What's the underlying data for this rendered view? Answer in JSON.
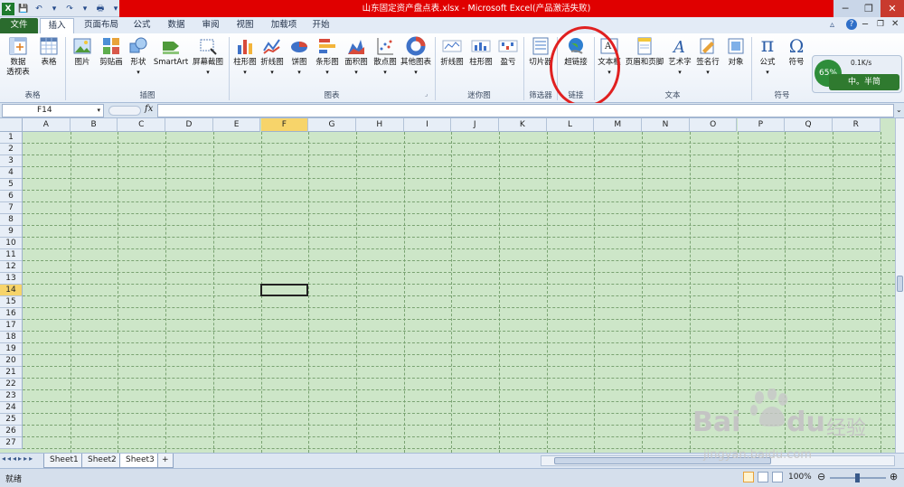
{
  "title_bar": {
    "title": "山东固定资产盘点表.xlsx - Microsoft Excel(产品激活失败)"
  },
  "ribbon_tabs": [
    "文件",
    "插入",
    "页面布局",
    "公式",
    "数据",
    "审阅",
    "视图",
    "加载项",
    "开始"
  ],
  "ribbon": {
    "buttons": [
      {
        "key": "pivot",
        "label": "数据\n透视表"
      },
      {
        "key": "table",
        "label": "表格"
      },
      {
        "key": "picture",
        "label": "图片"
      },
      {
        "key": "clipart",
        "label": "剪贴画"
      },
      {
        "key": "shapes",
        "label": "形状"
      },
      {
        "key": "smartart",
        "label": "SmartArt"
      },
      {
        "key": "screenshot",
        "label": "屏幕截图"
      },
      {
        "key": "column_chart",
        "label": "柱形图"
      },
      {
        "key": "line_chart",
        "label": "折线图"
      },
      {
        "key": "pie_chart",
        "label": "饼图"
      },
      {
        "key": "bar_chart",
        "label": "条形图"
      },
      {
        "key": "area_chart",
        "label": "面积图"
      },
      {
        "key": "scatter_chart",
        "label": "散点图"
      },
      {
        "key": "other_chart",
        "label": "其他图表"
      },
      {
        "key": "spark_line",
        "label": "折线图"
      },
      {
        "key": "spark_column",
        "label": "柱形图"
      },
      {
        "key": "spark_winloss",
        "label": "盈亏"
      },
      {
        "key": "slicer",
        "label": "切片器"
      },
      {
        "key": "hyperlink",
        "label": "超链接"
      },
      {
        "key": "textbox",
        "label": "文本框"
      },
      {
        "key": "header_footer",
        "label": "页眉和页脚"
      },
      {
        "key": "wordart",
        "label": "艺术字"
      },
      {
        "key": "signature",
        "label": "签名行"
      },
      {
        "key": "object",
        "label": "对象"
      },
      {
        "key": "equation",
        "label": "公式"
      },
      {
        "key": "symbol",
        "label": "符号"
      }
    ],
    "groups": [
      "表格",
      "插图",
      "图表",
      "迷你图",
      "筛选器",
      "链接",
      "文本",
      "符号"
    ]
  },
  "overlay_widget": {
    "percent": "65%",
    "speed": "0.1K/s",
    "ime_text": "中。半简"
  },
  "formula_bar": {
    "name_box": "F14",
    "fx": "fx",
    "value": ""
  },
  "columns": [
    "A",
    "B",
    "C",
    "D",
    "E",
    "F",
    "G",
    "H",
    "I",
    "J",
    "K",
    "L",
    "M",
    "N",
    "O",
    "P",
    "Q",
    "R"
  ],
  "rows": [
    "1",
    "2",
    "3",
    "4",
    "5",
    "6",
    "7",
    "8",
    "9",
    "10",
    "11",
    "12",
    "13",
    "14",
    "15",
    "16",
    "17",
    "18",
    "19",
    "20",
    "21",
    "22",
    "23",
    "24",
    "25",
    "26",
    "27"
  ],
  "selected_cell": {
    "column": "F",
    "row": "14"
  },
  "sheets": [
    "Sheet1",
    "Sheet2",
    "Sheet3"
  ],
  "active_sheet": "Sheet3",
  "status_bar": {
    "status": "就绪",
    "zoom": "100%"
  },
  "watermark": {
    "brand": "Bai",
    "brand2": "du",
    "cn": "经验",
    "url": "jingyan.baidu.com"
  },
  "colors": {
    "title_red": "#e00000",
    "file_tab": "#2a6b2d",
    "grid_fill": "#cde6c8",
    "highlight_circle": "#e02020"
  }
}
